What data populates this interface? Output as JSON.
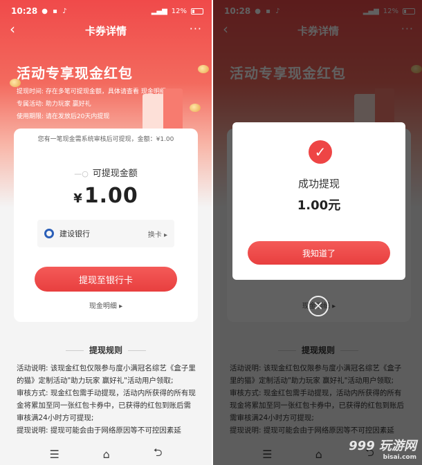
{
  "status": {
    "time": "10:28",
    "battery": "12%"
  },
  "nav": {
    "title": "卡券详情",
    "back": "‹",
    "more": "···"
  },
  "promo": {
    "title": "活动专享现金红包",
    "lines": [
      {
        "label": "提现时间:",
        "text": "存在多笔可提现金额，具体请查看",
        "link": "现金明细"
      },
      {
        "label": "专属活动:",
        "text": "助力玩家 赢好礼"
      },
      {
        "label": "使用期限:",
        "text": "请在发放后20天内提现"
      }
    ]
  },
  "card": {
    "notice": "您有一笔现金需系统审核后可提现，金额：¥1.00",
    "amount_label": "可提现金额",
    "currency": "¥",
    "amount": "1.00",
    "bank_name": "建设银行",
    "change_card": "换卡",
    "withdraw_button": "提现至银行卡",
    "detail_link": "现金明细"
  },
  "rules": {
    "title": "提现规则",
    "text": [
      "活动说明: 该现金红包仅限参与度小满冠名综艺《盒子里的猫》定制活动\"助力玩家 赢好礼\"活动用户领取;",
      "审核方式: 现金红包需手动提现，活动内所获得的所有现金将累加至同一张红包卡券中，已获得的红包到账后需审核满24小时方可提现;",
      "提现说明: 提现可能会由于网络原因等不可控因素延"
    ]
  },
  "dialog": {
    "title": "成功提现",
    "amount": "1.00元",
    "ok_button": "我知道了"
  },
  "bottom_nav": {
    "menu": "☰",
    "home": "⌂",
    "back": "⮌"
  },
  "watermark": {
    "brand": "999 玩游网",
    "site": "bisai.com"
  },
  "colors": {
    "accent": "#ee4545",
    "hero": "#f04a4a"
  }
}
